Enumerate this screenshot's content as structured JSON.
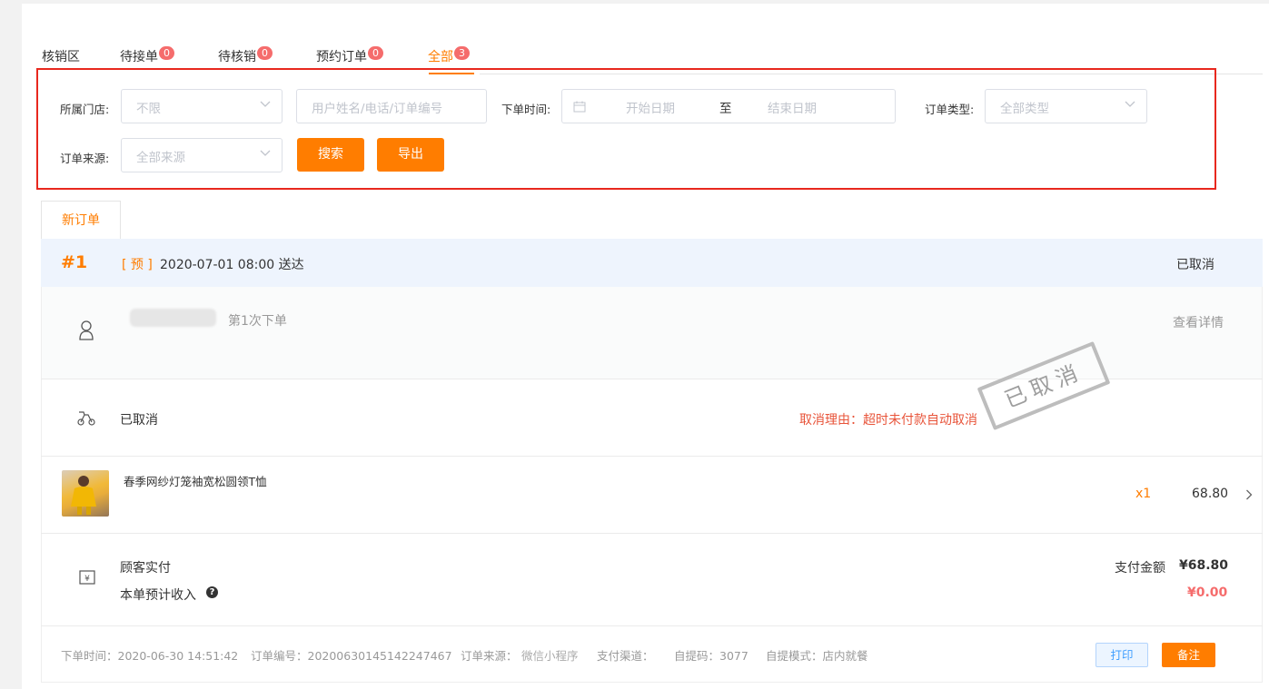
{
  "tabs": [
    {
      "label": "核销区"
    },
    {
      "label": "待接单",
      "badge": "0"
    },
    {
      "label": "待核销",
      "badge": "0"
    },
    {
      "label": "预约订单",
      "badge": "0"
    },
    {
      "label": "全部",
      "badge": "3",
      "active": true
    }
  ],
  "filters": {
    "store_label": "所属门店:",
    "store_value": "不限",
    "keyword_placeholder": "用户姓名/电话/订单编号",
    "time_label": "下单时间:",
    "start_placeholder": "开始日期",
    "range_separator": "至",
    "end_placeholder": "结束日期",
    "type_label": "订单类型:",
    "type_value": "全部类型",
    "source_label": "订单来源:",
    "source_value": "全部来源",
    "search_button": "搜索",
    "export_button": "导出"
  },
  "sub_tab": "新订单",
  "order": {
    "number": "#1",
    "tag": "[ 预 ]",
    "delivery": "2020-07-01 08:00 送达",
    "status": "已取消",
    "customer_order_count": "第1次下单",
    "view_details": "查看详情",
    "delivery_status": "已取消",
    "cancel_reason": "取消理由：超时未付款自动取消",
    "stamp_text": "已取消",
    "item": {
      "name": "春季网纱灯笼袖宽松圆领T恤",
      "qty": "x1",
      "price": "68.80"
    },
    "paid_label": "顾客实付",
    "income_label": "本单预计收入",
    "pay_amount_label": "支付金额",
    "pay_amount": "¥68.80",
    "income_amount": "¥0.00",
    "footer": {
      "order_time": "下单时间：2020-06-30 14:51:42",
      "order_no": "订单编号：20200630145142247467",
      "source_label": "订单来源：",
      "source_value": "微信小程序",
      "channel": "支付渠道：",
      "pickup_code": "自提码：3077",
      "pickup_mode": "自提模式：店内就餐"
    },
    "print_button": "打印",
    "note_button": "备注"
  },
  "colors": {
    "accent": "#ff7d00",
    "badge": "#f56c6c",
    "cancel_reason": "#e8543a",
    "highlight_border": "#e8281e",
    "header_bg": "#eef4fd"
  }
}
